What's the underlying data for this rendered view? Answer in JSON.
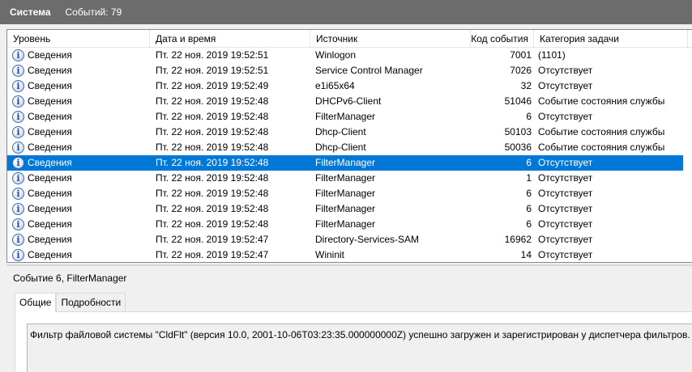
{
  "header": {
    "title": "Система",
    "count": "Событий: 79"
  },
  "table": {
    "columns": {
      "level": "Уровень",
      "date": "Дата и время",
      "source": "Источник",
      "code": "Код события",
      "category": "Категория задачи"
    },
    "rows": [
      {
        "level": "Сведения",
        "date": "Пт. 22 ноя. 2019 19:52:51",
        "source": "Winlogon",
        "code": "7001",
        "category": "(1101)"
      },
      {
        "level": "Сведения",
        "date": "Пт. 22 ноя. 2019 19:52:51",
        "source": "Service Control Manager",
        "code": "7026",
        "category": "Отсутствует"
      },
      {
        "level": "Сведения",
        "date": "Пт. 22 ноя. 2019 19:52:49",
        "source": "e1i65x64",
        "code": "32",
        "category": "Отсутствует"
      },
      {
        "level": "Сведения",
        "date": "Пт. 22 ноя. 2019 19:52:48",
        "source": "DHCPv6-Client",
        "code": "51046",
        "category": "Событие состояния службы"
      },
      {
        "level": "Сведения",
        "date": "Пт. 22 ноя. 2019 19:52:48",
        "source": "FilterManager",
        "code": "6",
        "category": "Отсутствует"
      },
      {
        "level": "Сведения",
        "date": "Пт. 22 ноя. 2019 19:52:48",
        "source": "Dhcp-Client",
        "code": "50103",
        "category": "Событие состояния службы"
      },
      {
        "level": "Сведения",
        "date": "Пт. 22 ноя. 2019 19:52:48",
        "source": "Dhcp-Client",
        "code": "50036",
        "category": "Событие состояния службы"
      },
      {
        "level": "Сведения",
        "date": "Пт. 22 ноя. 2019 19:52:48",
        "source": "FilterManager",
        "code": "6",
        "category": "Отсутствует"
      },
      {
        "level": "Сведения",
        "date": "Пт. 22 ноя. 2019 19:52:48",
        "source": "FilterManager",
        "code": "1",
        "category": "Отсутствует"
      },
      {
        "level": "Сведения",
        "date": "Пт. 22 ноя. 2019 19:52:48",
        "source": "FilterManager",
        "code": "6",
        "category": "Отсутствует"
      },
      {
        "level": "Сведения",
        "date": "Пт. 22 ноя. 2019 19:52:48",
        "source": "FilterManager",
        "code": "6",
        "category": "Отсутствует"
      },
      {
        "level": "Сведения",
        "date": "Пт. 22 ноя. 2019 19:52:48",
        "source": "FilterManager",
        "code": "6",
        "category": "Отсутствует"
      },
      {
        "level": "Сведения",
        "date": "Пт. 22 ноя. 2019 19:52:47",
        "source": "Directory-Services-SAM",
        "code": "16962",
        "category": "Отсутствует"
      },
      {
        "level": "Сведения",
        "date": "Пт. 22 ноя. 2019 19:52:47",
        "source": "Wininit",
        "code": "14",
        "category": "Отсутствует"
      }
    ],
    "selected_index": 7,
    "row_icon": "info-icon",
    "selection_color": "#0078d7"
  },
  "detail": {
    "title": "Событие 6, FilterManager",
    "tabs": [
      {
        "label": "Общие",
        "active": true
      },
      {
        "label": "Подробности",
        "active": false
      }
    ],
    "message": "Фильтр файловой системы \"CldFlt\" (версия 10.0, 2001-10-06T03:23:35.000000000Z) успешно загружен и зарегистрирован у диспетчера фильтров."
  }
}
